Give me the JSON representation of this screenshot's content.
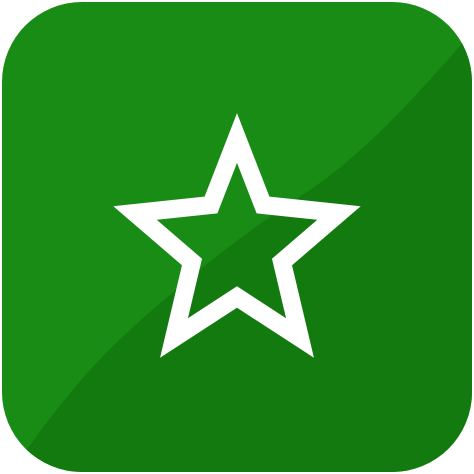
{
  "app_icon": {
    "icon_name": "star-icon",
    "background_color": "#188c14",
    "shade_color": "#137a10",
    "star_color": "#ffffff"
  }
}
